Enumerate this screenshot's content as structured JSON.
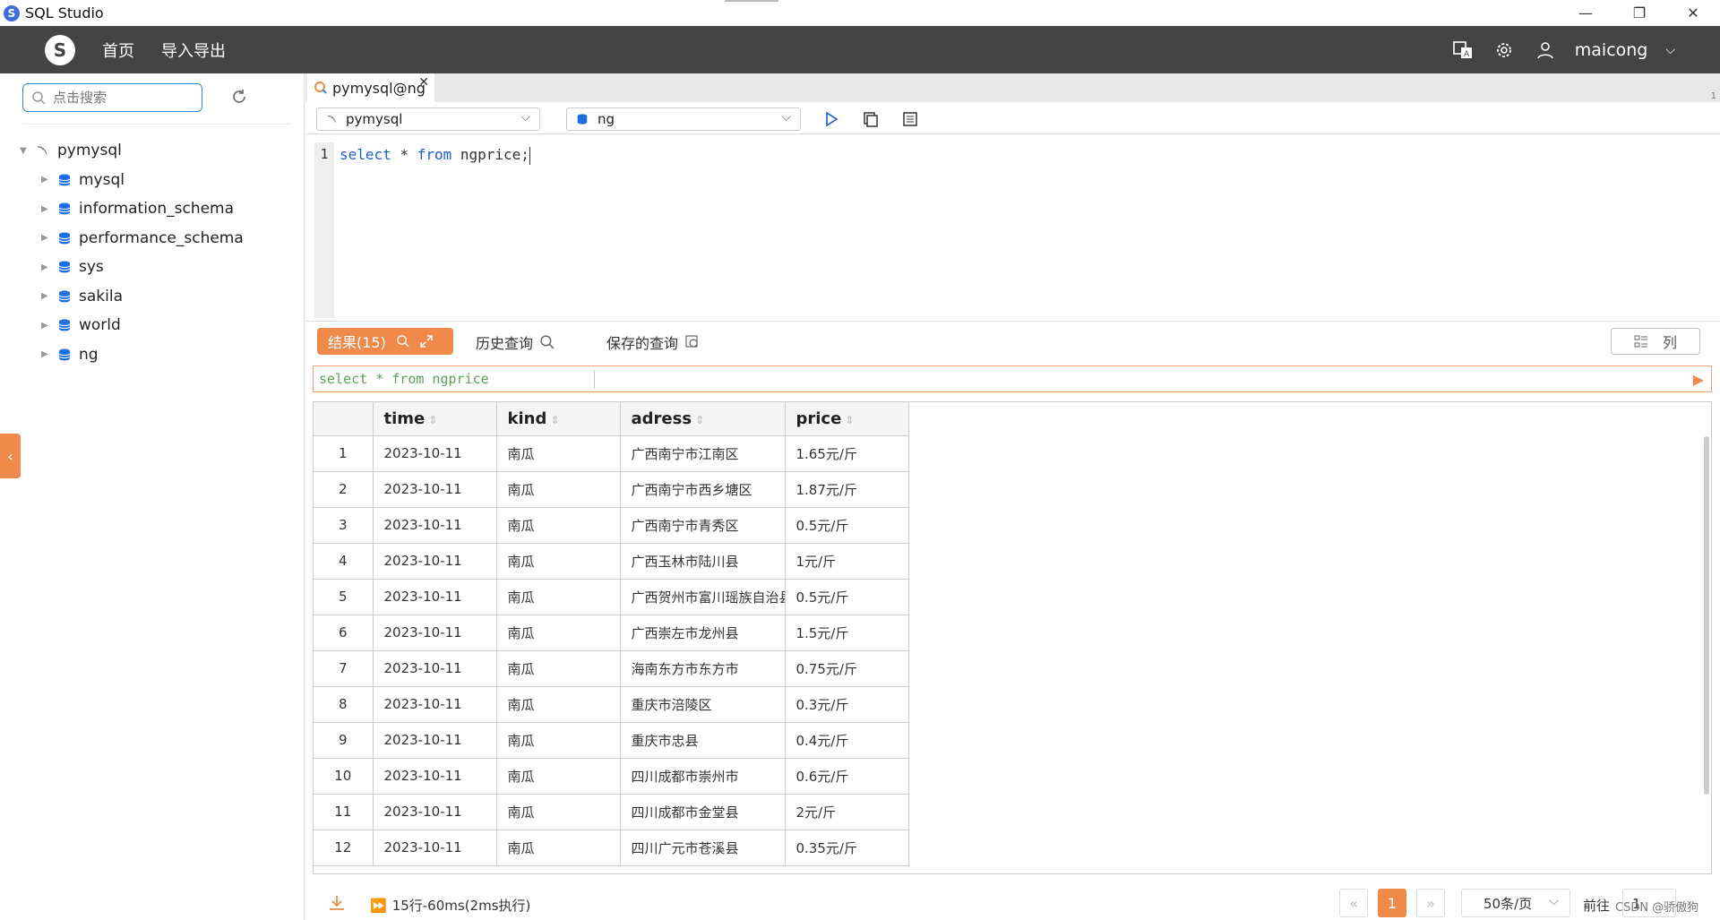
{
  "window": {
    "title": "SQL Studio",
    "minimize": "—",
    "maximize": "❐",
    "close": "✕"
  },
  "header": {
    "nav": [
      "首页",
      "导入导出"
    ],
    "user": "maicong"
  },
  "sidebar": {
    "search_placeholder": "点击搜索",
    "connection": "pymysql",
    "databases": [
      "mysql",
      "information_schema",
      "performance_schema",
      "sys",
      "sakila",
      "world",
      "ng"
    ]
  },
  "tabs": [
    {
      "label": "pymysql@ng"
    }
  ],
  "tab_counter": "1",
  "toolbar": {
    "connection": "pymysql",
    "database": "ng"
  },
  "editor": {
    "line": "1",
    "sql_kw1": "select",
    "sql_star": " * ",
    "sql_kw2": "from",
    "sql_rest": " ngprice;"
  },
  "results": {
    "results_tab": "结果(15)",
    "history_tab": "历史查询",
    "saved_tab": "保存的查询",
    "columns_button": "列",
    "query_echo": "select * from ngprice",
    "headers": [
      "time",
      "kind",
      "adress",
      "price"
    ],
    "rows": [
      [
        "1",
        "2023-10-11",
        "南瓜",
        "广西南宁市江南区",
        "1.65元/斤"
      ],
      [
        "2",
        "2023-10-11",
        "南瓜",
        "广西南宁市西乡塘区",
        "1.87元/斤"
      ],
      [
        "3",
        "2023-10-11",
        "南瓜",
        "广西南宁市青秀区",
        "0.5元/斤"
      ],
      [
        "4",
        "2023-10-11",
        "南瓜",
        "广西玉林市陆川县",
        "1元/斤"
      ],
      [
        "5",
        "2023-10-11",
        "南瓜",
        "广西贺州市富川瑶族自治县",
        "0.5元/斤"
      ],
      [
        "6",
        "2023-10-11",
        "南瓜",
        "广西崇左市龙州县",
        "1.5元/斤"
      ],
      [
        "7",
        "2023-10-11",
        "南瓜",
        "海南东方市东方市",
        "0.75元/斤"
      ],
      [
        "8",
        "2023-10-11",
        "南瓜",
        "重庆市涪陵区",
        "0.3元/斤"
      ],
      [
        "9",
        "2023-10-11",
        "南瓜",
        "重庆市忠县",
        "0.4元/斤"
      ],
      [
        "10",
        "2023-10-11",
        "南瓜",
        "四川成都市崇州市",
        "0.6元/斤"
      ],
      [
        "11",
        "2023-10-11",
        "南瓜",
        "四川成都市金堂县",
        "2元/斤"
      ],
      [
        "12",
        "2023-10-11",
        "南瓜",
        "四川广元市苍溪县",
        "0.35元/斤"
      ]
    ]
  },
  "footer": {
    "status": "15行-60ms(2ms执行)",
    "current_page": "1",
    "page_size": "50条/页",
    "goto_label": "前往",
    "goto_value": "1",
    "watermark": "CSDN @骄傲狗"
  },
  "colors": {
    "accent": "#f08a4b",
    "header_bg": "#444444",
    "link_blue": "#1c5fd6"
  }
}
